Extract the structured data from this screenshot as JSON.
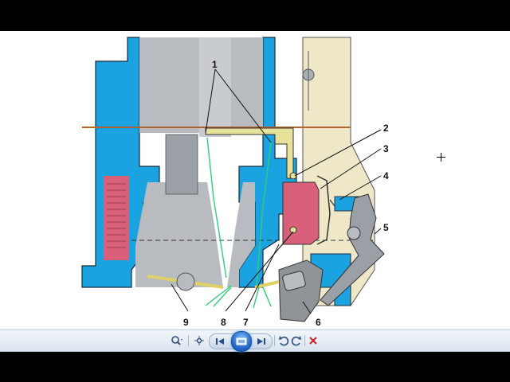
{
  "diagram": {
    "callouts": [
      "1",
      "2",
      "3",
      "4",
      "5",
      "6",
      "7",
      "8",
      "9"
    ]
  },
  "colors": {
    "body_blue": "#1aa3e0",
    "metal_gray": "#b8bcc0",
    "fuel_pink": "#d9607a",
    "channel_yellow": "#e6e29a",
    "airflow_green": "#2fcf7a",
    "housing_tan": "#eee7c8",
    "toolbar_accent": "#2a78d8"
  },
  "toolbar": {
    "icons": [
      "zoom-icon",
      "fit-to-window-icon",
      "previous-icon",
      "slideshow-icon",
      "next-icon",
      "rotate-left-icon",
      "rotate-right-icon",
      "delete-icon"
    ]
  }
}
